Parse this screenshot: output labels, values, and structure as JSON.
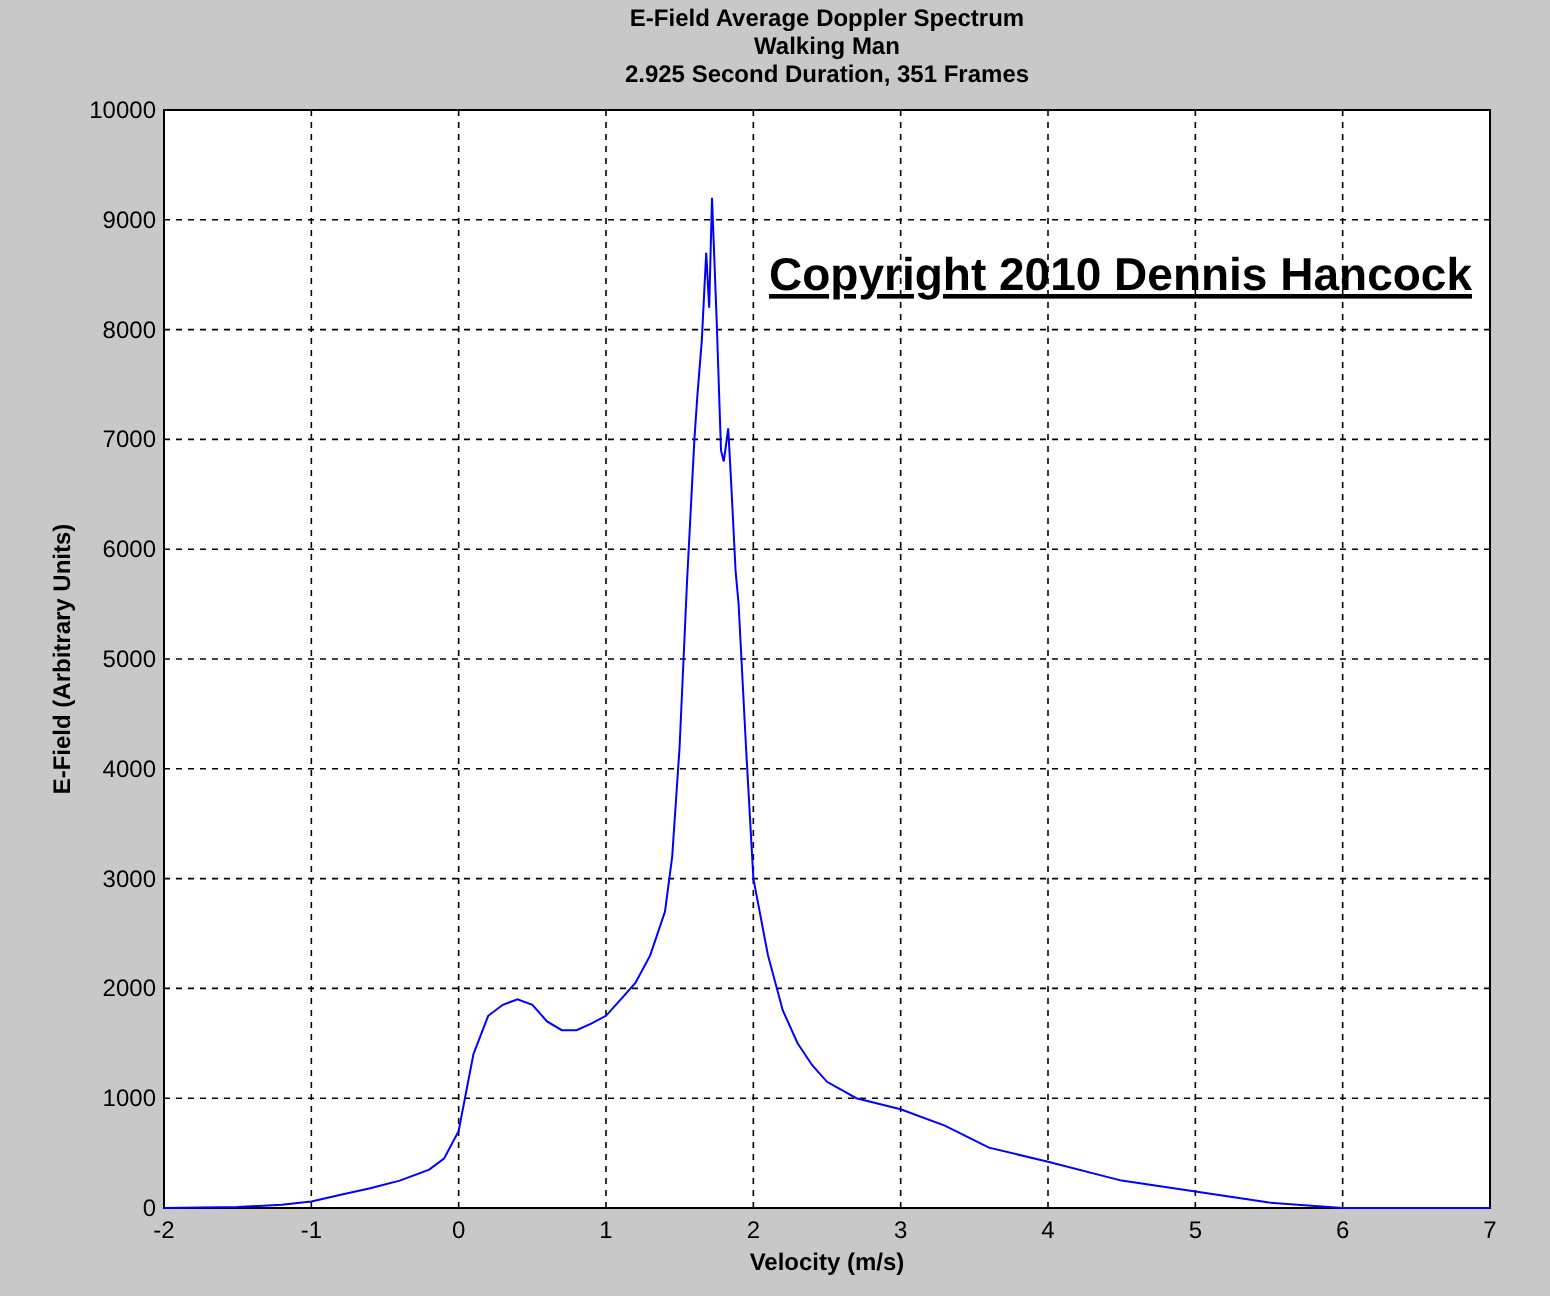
{
  "figure": {
    "chart_data": {
      "type": "line",
      "title": [
        "E-Field Average Doppler Spectrum",
        "Walking Man",
        "2.925 Second Duration, 351 Frames"
      ],
      "xlabel": "Velocity (m/s)",
      "ylabel": "E-Field (Arbitrary Units)",
      "x": [
        -2,
        -1.5,
        -1.2,
        -1,
        -0.8,
        -0.6,
        -0.4,
        -0.2,
        -0.1,
        0,
        0.1,
        0.2,
        0.3,
        0.4,
        0.5,
        0.6,
        0.7,
        0.8,
        0.9,
        1,
        1.1,
        1.2,
        1.3,
        1.4,
        1.45,
        1.5,
        1.55,
        1.6,
        1.62,
        1.65,
        1.68,
        1.7,
        1.72,
        1.75,
        1.78,
        1.8,
        1.83,
        1.85,
        1.88,
        1.9,
        1.95,
        2,
        2.1,
        2.2,
        2.3,
        2.4,
        2.5,
        2.7,
        3,
        3.3,
        3.6,
        4,
        4.5,
        5,
        5.5,
        6,
        6.2,
        7
      ],
      "grid": true,
      "series": [
        {
          "color": "#0000ff",
          "values": [
            0,
            10,
            30,
            60,
            120,
            180,
            250,
            350,
            450,
            700,
            1400,
            1750,
            1850,
            1900,
            1850,
            1700,
            1620,
            1620,
            1680,
            1750,
            1900,
            2050,
            2300,
            2700,
            3200,
            4200,
            5700,
            7000,
            7400,
            7900,
            8700,
            8200,
            9200,
            8100,
            6900,
            6800,
            7100,
            6600,
            5800,
            5500,
            4200,
            3000,
            2300,
            1800,
            1500,
            1300,
            1150,
            1000,
            900,
            750,
            550,
            420,
            250,
            150,
            50,
            0,
            0,
            0
          ]
        }
      ],
      "xlim": [
        -2,
        7
      ],
      "ylim": [
        0,
        10000
      ],
      "xticks": [
        -2,
        -1,
        0,
        1,
        2,
        3,
        4,
        5,
        6,
        7
      ],
      "yticks": [
        0,
        1000,
        2000,
        3000,
        4000,
        5000,
        6000,
        7000,
        8000,
        9000,
        10000
      ],
      "annotations": [
        "Copyright 2010 Dennis Hancock"
      ]
    }
  }
}
